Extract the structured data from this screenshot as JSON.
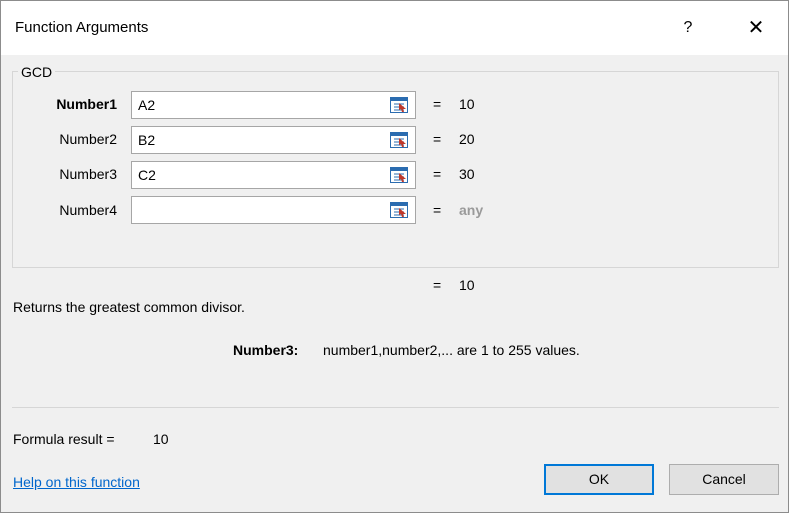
{
  "dialog": {
    "title": "Function Arguments",
    "help_label": "?",
    "close_label": "✕"
  },
  "function": {
    "name": "GCD"
  },
  "args": [
    {
      "label": "Number1",
      "value": "A2",
      "result": "10"
    },
    {
      "label": "Number2",
      "value": "B2",
      "result": "20"
    },
    {
      "label": "Number3",
      "value": "C2",
      "result": "30"
    },
    {
      "label": "Number4",
      "value": "",
      "result": "any"
    }
  ],
  "equals_sign": "=",
  "overall_result": "10",
  "description": "Returns the greatest common divisor.",
  "arg_help": {
    "name": "Number3:",
    "text": "number1,number2,... are 1 to 255 values."
  },
  "formula_result": {
    "label": "Formula result =",
    "value": "10"
  },
  "help_link": "Help on this function",
  "buttons": {
    "ok": "OK",
    "cancel": "Cancel"
  }
}
